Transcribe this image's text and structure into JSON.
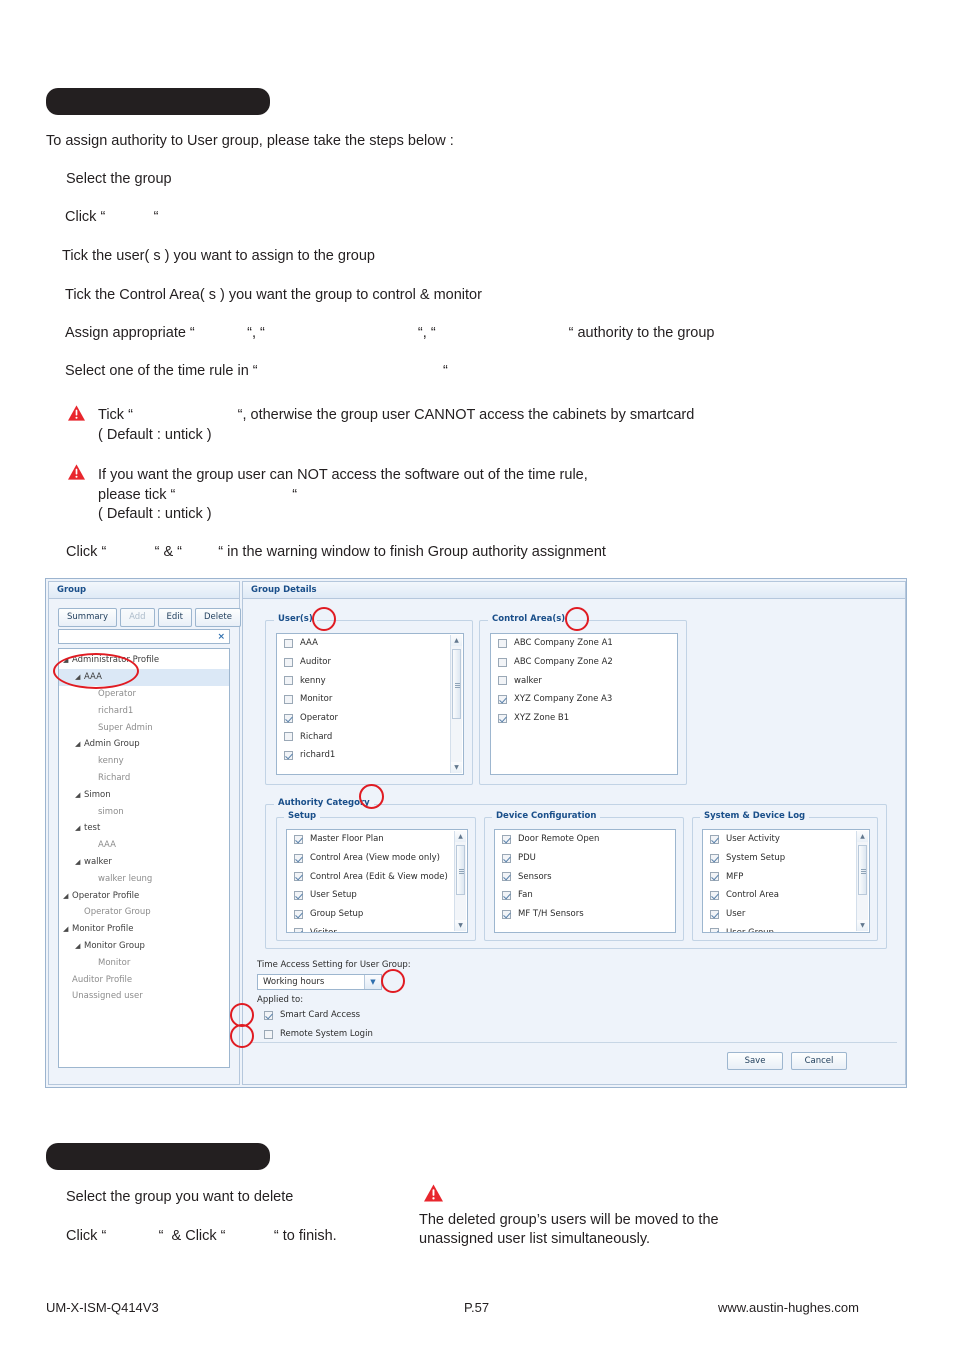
{
  "document": {
    "intro": "To assign authority to User group, please take the steps below :",
    "steps": [
      "Select the group",
      "Click “            “",
      "Tick the user( s ) you want to assign to the group",
      "Tick the Control Area( s ) you want the group to control & monitor",
      "Assign appropriate “             “, “                                      “, “                                 “ authority to the group",
      "Select one of the time rule in “                                              “"
    ],
    "warnings": [
      {
        "line1": "Tick “                          “, otherwise the group user CANNOT access the cabinets by smartcard",
        "line2": "( Default : untick )"
      },
      {
        "line1": "If you want the group user can NOT access the software out of the time rule,",
        "line2": "please tick “                             “",
        "line3": "( Default : untick )"
      }
    ],
    "final_step": "Click “            “ & “         “ in the warning window to finish Group authority assignment",
    "delete_section": {
      "step1": "Select the group you want to delete",
      "step2": "Click “             “  & Click “            “ to finish.",
      "note_line1": "The deleted group’s users will be moved to the",
      "note_line2": "unassigned user list simultaneously."
    }
  },
  "footer": {
    "left": "UM-X-ISM-Q414V3",
    "center": "P.57",
    "right": "www.austin-hughes.com"
  },
  "app": {
    "group_panel": {
      "title": "Group",
      "toolbar": {
        "summary": "Summary",
        "add": "Add",
        "edit": "Edit",
        "delete": "Delete"
      },
      "search_value": "",
      "clear_icon": "×",
      "tree": [
        {
          "label": "Administrator Profile",
          "level": 0,
          "expandable": true,
          "selected": false
        },
        {
          "label": "AAA",
          "level": 1,
          "expandable": true,
          "selected": true
        },
        {
          "label": "Operator",
          "level": 2,
          "expandable": false,
          "selected": false
        },
        {
          "label": "richard1",
          "level": 2,
          "expandable": false,
          "selected": false
        },
        {
          "label": "Super Admin",
          "level": 2,
          "expandable": false,
          "selected": false
        },
        {
          "label": "Admin Group",
          "level": 1,
          "expandable": true,
          "selected": false
        },
        {
          "label": "kenny",
          "level": 2,
          "expandable": false,
          "selected": false
        },
        {
          "label": "Richard",
          "level": 2,
          "expandable": false,
          "selected": false
        },
        {
          "label": "Simon",
          "level": 1,
          "expandable": true,
          "selected": false
        },
        {
          "label": "simon",
          "level": 2,
          "expandable": false,
          "selected": false
        },
        {
          "label": "test",
          "level": 1,
          "expandable": true,
          "selected": false
        },
        {
          "label": "AAA",
          "level": 2,
          "expandable": false,
          "selected": false
        },
        {
          "label": "walker",
          "level": 1,
          "expandable": true,
          "selected": false
        },
        {
          "label": "walker leung",
          "level": 2,
          "expandable": false,
          "selected": false
        },
        {
          "label": "Operator Profile",
          "level": 0,
          "expandable": true,
          "selected": false
        },
        {
          "label": "Operator Group",
          "level": 1,
          "expandable": false,
          "selected": false
        },
        {
          "label": "Monitor Profile",
          "level": 0,
          "expandable": true,
          "selected": false
        },
        {
          "label": "Monitor Group",
          "level": 1,
          "expandable": true,
          "selected": false
        },
        {
          "label": "Monitor",
          "level": 2,
          "expandable": false,
          "selected": false
        },
        {
          "label": "Auditor Profile",
          "level": 0,
          "expandable": false,
          "selected": false
        },
        {
          "label": "Unassigned user",
          "level": 0,
          "expandable": false,
          "selected": false
        }
      ]
    },
    "details_panel": {
      "title": "Group Details",
      "users": {
        "legend": "User(s)",
        "items": [
          {
            "label": "AAA",
            "checked": false
          },
          {
            "label": "Auditor",
            "checked": false
          },
          {
            "label": "kenny",
            "checked": false
          },
          {
            "label": "Monitor",
            "checked": false
          },
          {
            "label": "Operator",
            "checked": true
          },
          {
            "label": "Richard",
            "checked": false
          },
          {
            "label": "richard1",
            "checked": true
          }
        ]
      },
      "control_areas": {
        "legend": "Control Area(s)",
        "items": [
          {
            "label": "ABC Company Zone A1",
            "checked": false
          },
          {
            "label": "ABC Company Zone A2",
            "checked": false
          },
          {
            "label": "walker",
            "checked": false
          },
          {
            "label": "XYZ Company Zone A3",
            "checked": true
          },
          {
            "label": "XYZ Zone B1",
            "checked": true
          }
        ]
      },
      "authority_category": {
        "legend": "Authority Category",
        "setup": {
          "legend": "Setup",
          "items": [
            {
              "label": "Master Floor Plan",
              "checked": true
            },
            {
              "label": "Control Area (View mode only)",
              "checked": true
            },
            {
              "label": "Control Area (Edit & View mode)",
              "checked": true
            },
            {
              "label": "User Setup",
              "checked": true
            },
            {
              "label": "Group Setup",
              "checked": true
            },
            {
              "label": "Visitor",
              "checked": true
            }
          ]
        },
        "device_configuration": {
          "legend": "Device Configuration",
          "items": [
            {
              "label": "Door Remote Open",
              "checked": true
            },
            {
              "label": "PDU",
              "checked": true
            },
            {
              "label": "Sensors",
              "checked": true
            },
            {
              "label": "Fan",
              "checked": true
            },
            {
              "label": "MF T/H Sensors",
              "checked": true
            }
          ]
        },
        "system_device_log": {
          "legend": "System & Device Log",
          "items": [
            {
              "label": "User Activity",
              "checked": true
            },
            {
              "label": "System Setup",
              "checked": true
            },
            {
              "label": "MFP",
              "checked": true
            },
            {
              "label": "Control Area",
              "checked": true
            },
            {
              "label": "User",
              "checked": true
            },
            {
              "label": "User Group",
              "checked": true
            }
          ]
        }
      },
      "time_access": {
        "label": "Time Access Setting for User Group:",
        "selected": "Working hours",
        "applied_to_label": "Applied to:",
        "applied_to": [
          {
            "label": "Smart Card Access",
            "checked": true
          },
          {
            "label": "Remote System Login",
            "checked": false
          }
        ]
      },
      "buttons": {
        "save": "Save",
        "cancel": "Cancel"
      }
    }
  },
  "colors": {
    "annotation_red": "#e01b22",
    "panel_title_blue": "#1a4f8a",
    "app_bg": "#eef3fa",
    "warning_red": "#e8262d"
  }
}
